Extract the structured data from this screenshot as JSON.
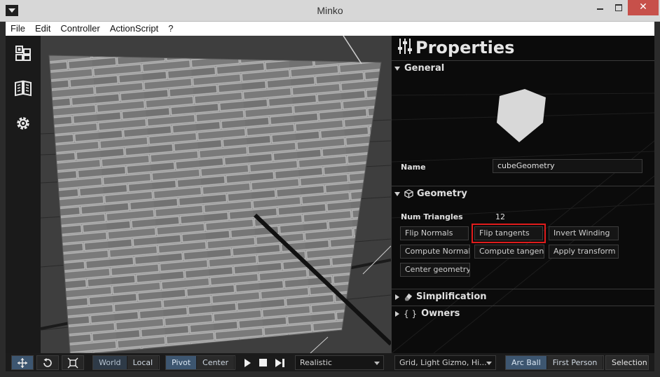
{
  "window": {
    "title": "Minko"
  },
  "menu": {
    "items": [
      "File",
      "Edit",
      "Controller",
      "ActionScript",
      "?"
    ]
  },
  "left_toolbar": {
    "icons": [
      "scene-graph-icon",
      "library-book-icon",
      "gear-icon"
    ]
  },
  "properties": {
    "title": "Properties",
    "general": {
      "title": "General",
      "name_label": "Name",
      "name_value": "cubeGeometry"
    },
    "geometry": {
      "title": "Geometry",
      "num_triangles_label": "Num Triangles",
      "num_triangles_value": "12",
      "buttons": {
        "flip_normals": "Flip Normals",
        "flip_tangents": "Flip tangents",
        "invert_winding": "Invert Winding",
        "compute_normals": "Compute Normals",
        "compute_tangents": "Compute tangents",
        "apply_transform": "Apply transform",
        "center_geometry": "Center geometry"
      }
    },
    "simplification": {
      "title": "Simplification"
    },
    "owners": {
      "title": "Owners",
      "icon_text": "{ }"
    }
  },
  "bottom_bar": {
    "transform_modes": [
      "translate-icon",
      "rotate-icon",
      "scale-icon"
    ],
    "space": {
      "world": "World",
      "local": "Local",
      "active": "World"
    },
    "pivot": {
      "pivot": "Pivot",
      "center": "Center",
      "active": "Pivot"
    },
    "render_mode": "Realistic",
    "display_options": "Grid, Light Gizmo, Hi...",
    "camera": {
      "arcball": "Arc Ball",
      "first_person": "First Person",
      "active": "Arc Ball"
    },
    "selection_label": "Selection"
  },
  "colors": {
    "accent": "#3d5670",
    "highlight_box": "#e01c1c",
    "close_button": "#c7504a"
  }
}
